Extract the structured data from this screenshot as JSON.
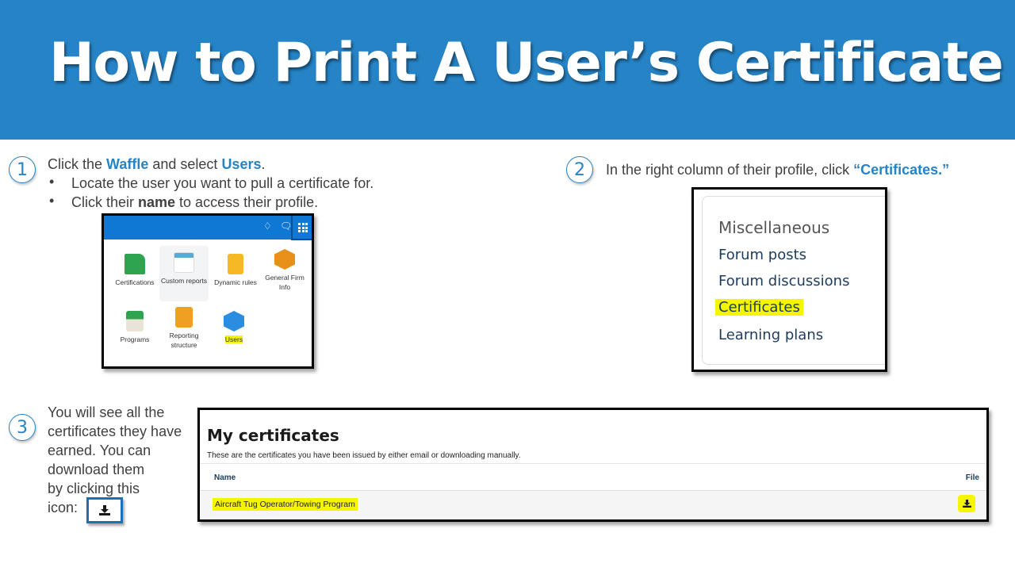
{
  "title": "How to Print A User’s Certificate",
  "colors": {
    "brand_blue": "#2683c6",
    "highlight": "#f5f500"
  },
  "step1": {
    "number": "1",
    "line_pre": "Click the ",
    "waffle": "Waffle",
    "line_mid": " and select ",
    "users": "Users",
    "line_end": ".",
    "bullets": [
      {
        "text": "Locate the user you want to pull a certificate for."
      },
      {
        "pre": "Click their ",
        "bold": "name",
        "post": " to access their profile."
      }
    ],
    "screenshot": {
      "topbar_icons": [
        "bell-icon",
        "chat-icon",
        "waffle-icon"
      ],
      "tiles": [
        {
          "label": "Certifications"
        },
        {
          "label": "Custom reports"
        },
        {
          "label": "Dynamic rules"
        },
        {
          "label": "General Firm Info"
        },
        {
          "label": "Programs"
        },
        {
          "label": "Reporting structure"
        },
        {
          "label": "Users"
        }
      ]
    }
  },
  "step2": {
    "number": "2",
    "text": "In the right column of their profile, click ",
    "link": "“Certificates.”",
    "screenshot": {
      "heading": "Miscellaneous",
      "items": [
        "Forum posts",
        "Forum discussions",
        "Certificates",
        "Learning plans"
      ]
    }
  },
  "step3": {
    "number": "3",
    "lines": [
      "You will see all the",
      "certificates they have",
      "earned. You can",
      "download them",
      "by clicking this",
      "icon:"
    ],
    "screenshot": {
      "heading": "My certificates",
      "description": "These are the certificates you have been issued by either email or downloading manually.",
      "columns": [
        "Name",
        "File"
      ],
      "rows": [
        {
          "name": "Aircraft Tug Operator/Towing Program"
        }
      ]
    }
  }
}
